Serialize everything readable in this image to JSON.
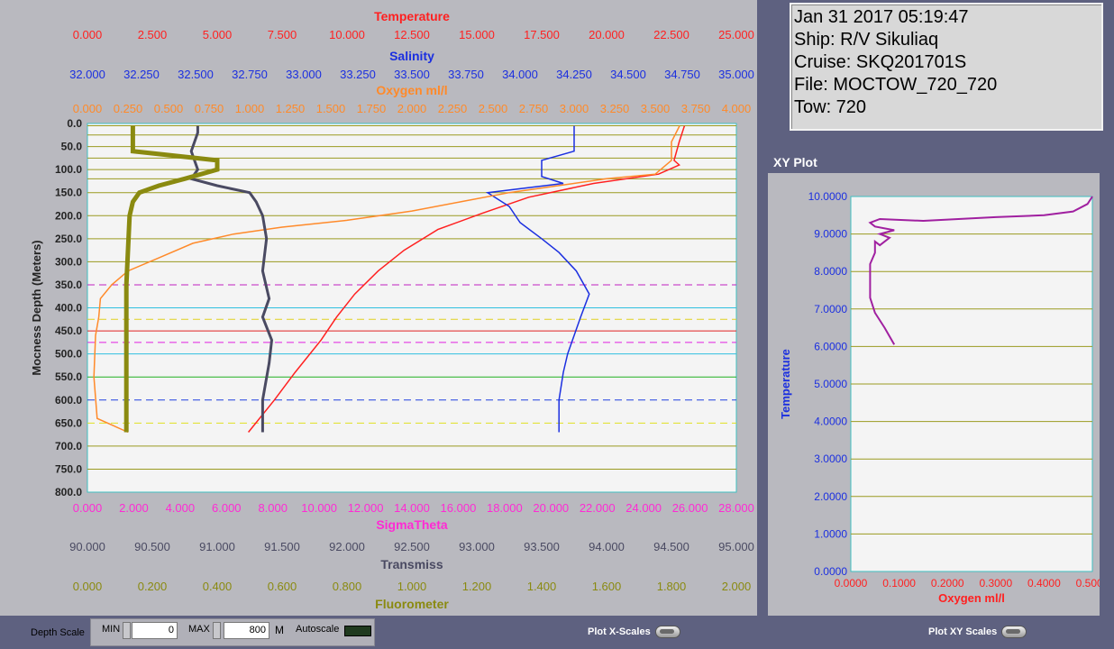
{
  "info": {
    "datetime": "Jan 31 2017 05:19:47",
    "ship": "Ship: R/V Sikuliaq",
    "cruise": "Cruise: SKQ201701S",
    "file": "File: MOCTOW_720_720",
    "tow": "Tow: 720"
  },
  "xy_plot": {
    "title": "XY Plot"
  },
  "bottom": {
    "depth_scale_label": "Depth Scale",
    "min_label": "MIN",
    "min_value": "0",
    "max_label": "MAX",
    "max_value": "800",
    "unit": "M",
    "autoscale_label": "Autoscale",
    "plot_x_scales_label": "Plot X-Scales",
    "plot_xy_scales_label": "Plot XY Scales"
  },
  "colors": {
    "temperature": "#ff2020",
    "salinity": "#1b2fe0",
    "oxygen": "#ff8a2a",
    "sigma_theta": "#ff2ad4",
    "transmiss": "#4a4a62",
    "fluorometer": "#8a8a10",
    "plot_bg": "#f4f4f4"
  },
  "chart_data": [
    {
      "type": "line",
      "ylabel": "Mocness Depth (Meters)",
      "ylim": [
        800,
        0
      ],
      "yticks": [
        "0.0",
        "50.0",
        "100.0",
        "150.0",
        "200.0",
        "250.0",
        "300.0",
        "350.0",
        "400.0",
        "450.0",
        "500.0",
        "550.0",
        "600.0",
        "650.0",
        "700.0",
        "750.0",
        "800.0"
      ],
      "top_axes": [
        {
          "name": "Temperature",
          "color": "#ff2020",
          "ticks": [
            "0.000",
            "2.500",
            "5.000",
            "7.500",
            "10.000",
            "12.500",
            "15.000",
            "17.500",
            "20.000",
            "22.500",
            "25.000"
          ]
        },
        {
          "name": "Salinity",
          "color": "#1b2fe0",
          "ticks": [
            "32.000",
            "32.250",
            "32.500",
            "32.750",
            "33.000",
            "33.250",
            "33.500",
            "33.750",
            "34.000",
            "34.250",
            "34.500",
            "34.750",
            "35.000"
          ]
        },
        {
          "name": "Oxygen ml/l",
          "color": "#ff8a2a",
          "ticks": [
            "0.000",
            "0.250",
            "0.500",
            "0.750",
            "1.000",
            "1.250",
            "1.500",
            "1.750",
            "2.000",
            "2.250",
            "2.500",
            "2.750",
            "3.000",
            "3.250",
            "3.500",
            "3.750",
            "4.000"
          ]
        }
      ],
      "bottom_axes": [
        {
          "name": "SigmaTheta",
          "color": "#ff2ad4",
          "ticks": [
            "0.000",
            "2.000",
            "4.000",
            "6.000",
            "8.000",
            "10.000",
            "12.000",
            "14.000",
            "16.000",
            "18.000",
            "20.000",
            "22.000",
            "24.000",
            "26.000",
            "28.000"
          ]
        },
        {
          "name": "Transmiss",
          "color": "#4a4a62",
          "ticks": [
            "90.000",
            "90.500",
            "91.000",
            "91.500",
            "92.000",
            "92.500",
            "93.000",
            "93.500",
            "94.000",
            "94.500",
            "95.000"
          ]
        },
        {
          "name": "Fluorometer",
          "color": "#8a8a10",
          "ticks": [
            "0.000",
            "0.200",
            "0.400",
            "0.600",
            "0.800",
            "1.000",
            "1.200",
            "1.400",
            "1.600",
            "1.800",
            "2.000"
          ]
        }
      ],
      "series": [
        {
          "name": "Temperature",
          "xlim": [
            0,
            25
          ],
          "points": [
            [
              6.2,
              670
            ],
            [
              7.2,
              600
            ],
            [
              8.0,
              540
            ],
            [
              9.0,
              470
            ],
            [
              9.6,
              420
            ],
            [
              10.3,
              370
            ],
            [
              11.2,
              320
            ],
            [
              12.2,
              275
            ],
            [
              13.5,
              230
            ],
            [
              15.2,
              195
            ],
            [
              17.0,
              160
            ],
            [
              19.5,
              130
            ],
            [
              22.0,
              110
            ],
            [
              22.8,
              90
            ],
            [
              22.6,
              80
            ],
            [
              22.8,
              40
            ],
            [
              23.0,
              5
            ]
          ]
        },
        {
          "name": "Salinity",
          "xlim": [
            32,
            35
          ],
          "points": [
            [
              34.18,
              670
            ],
            [
              34.18,
              600
            ],
            [
              34.2,
              540
            ],
            [
              34.22,
              500
            ],
            [
              34.28,
              420
            ],
            [
              34.32,
              370
            ],
            [
              34.26,
              320
            ],
            [
              34.18,
              280
            ],
            [
              34.1,
              250
            ],
            [
              34.0,
              215
            ],
            [
              33.95,
              180
            ],
            [
              33.85,
              150
            ],
            [
              34.2,
              130
            ],
            [
              34.1,
              115
            ],
            [
              34.1,
              80
            ],
            [
              34.25,
              60
            ],
            [
              34.25,
              5
            ]
          ]
        },
        {
          "name": "Oxygen ml/l",
          "xlim": [
            0,
            4
          ],
          "points": [
            [
              0.25,
              670
            ],
            [
              0.06,
              640
            ],
            [
              0.04,
              550
            ],
            [
              0.05,
              460
            ],
            [
              0.07,
              420
            ],
            [
              0.08,
              380
            ],
            [
              0.15,
              350
            ],
            [
              0.25,
              320
            ],
            [
              0.45,
              290
            ],
            [
              0.65,
              260
            ],
            [
              0.9,
              240
            ],
            [
              1.2,
              225
            ],
            [
              1.6,
              210
            ],
            [
              2.0,
              190
            ],
            [
              2.3,
              170
            ],
            [
              2.6,
              150
            ],
            [
              2.9,
              135
            ],
            [
              3.2,
              120
            ],
            [
              3.5,
              110
            ],
            [
              3.6,
              80
            ],
            [
              3.6,
              40
            ],
            [
              3.65,
              5
            ]
          ]
        },
        {
          "name": "Transmiss",
          "xlim": [
            90,
            95
          ],
          "points": [
            [
              91.35,
              670
            ],
            [
              91.35,
              600
            ],
            [
              91.4,
              520
            ],
            [
              91.42,
              470
            ],
            [
              91.35,
              420
            ],
            [
              91.4,
              380
            ],
            [
              91.35,
              320
            ],
            [
              91.38,
              250
            ],
            [
              91.35,
              200
            ],
            [
              91.3,
              170
            ],
            [
              91.25,
              150
            ],
            [
              91.0,
              135
            ],
            [
              90.8,
              120
            ],
            [
              90.85,
              100
            ],
            [
              90.8,
              60
            ],
            [
              90.85,
              20
            ],
            [
              90.85,
              5
            ]
          ]
        },
        {
          "name": "Fluorometer",
          "xlim": [
            0,
            2
          ],
          "points": [
            [
              0.12,
              670
            ],
            [
              0.12,
              350
            ],
            [
              0.13,
              200
            ],
            [
              0.14,
              170
            ],
            [
              0.16,
              150
            ],
            [
              0.22,
              135
            ],
            [
              0.3,
              120
            ],
            [
              0.4,
              100
            ],
            [
              0.4,
              80
            ],
            [
              0.14,
              60
            ],
            [
              0.14,
              5
            ]
          ]
        }
      ],
      "horizontal_lines": [
        {
          "y": 5,
          "color": "#9a9a20",
          "dash": false
        },
        {
          "y": 25,
          "color": "#9a9a20",
          "dash": false
        },
        {
          "y": 50,
          "color": "#9a9a20",
          "dash": false
        },
        {
          "y": 75,
          "color": "#9a9a20",
          "dash": false
        },
        {
          "y": 100,
          "color": "#9a9a20",
          "dash": false
        },
        {
          "y": 120,
          "color": "#9a9a20",
          "dash": false
        },
        {
          "y": 150,
          "color": "#9a9a20",
          "dash": false
        },
        {
          "y": 200,
          "color": "#9a9a20",
          "dash": false
        },
        {
          "y": 250,
          "color": "#9a9a20",
          "dash": false
        },
        {
          "y": 300,
          "color": "#9a9a20",
          "dash": false
        },
        {
          "y": 350,
          "color": "#c020c0",
          "dash": true
        },
        {
          "y": 400,
          "color": "#30c0e0",
          "dash": false
        },
        {
          "y": 425,
          "color": "#e0d020",
          "dash": true
        },
        {
          "y": 450,
          "color": "#e02020",
          "dash": false
        },
        {
          "y": 475,
          "color": "#e020e0",
          "dash": true
        },
        {
          "y": 500,
          "color": "#30c0e0",
          "dash": false
        },
        {
          "y": 550,
          "color": "#20b020",
          "dash": false
        },
        {
          "y": 600,
          "color": "#2040e0",
          "dash": true
        },
        {
          "y": 650,
          "color": "#e0e020",
          "dash": true
        },
        {
          "y": 700,
          "color": "#9a9a20",
          "dash": false
        },
        {
          "y": 750,
          "color": "#9a9a20",
          "dash": false
        }
      ]
    },
    {
      "type": "line",
      "xlabel": "Oxygen ml/l",
      "ylabel": "Temperature",
      "xlim": [
        0,
        0.5
      ],
      "ylim": [
        0,
        10
      ],
      "xticks": [
        "0.0000",
        "0.1000",
        "0.2000",
        "0.3000",
        "0.4000",
        "0.5000"
      ],
      "yticks": [
        "0.0000",
        "1.0000",
        "2.0000",
        "3.0000",
        "4.0000",
        "5.0000",
        "6.0000",
        "7.0000",
        "8.0000",
        "9.0000",
        "10.0000"
      ],
      "series": [
        {
          "name": "Temperature vs Oxygen",
          "x": [
            0.09,
            0.07,
            0.05,
            0.04,
            0.04,
            0.04,
            0.05,
            0.05,
            0.06,
            0.08,
            0.06,
            0.09,
            0.05,
            0.04,
            0.06,
            0.15,
            0.3,
            0.4,
            0.46,
            0.49,
            0.5
          ],
          "y": [
            6.05,
            6.5,
            6.9,
            7.3,
            7.8,
            8.2,
            8.5,
            8.8,
            8.7,
            8.9,
            9.0,
            9.1,
            9.2,
            9.3,
            9.4,
            9.35,
            9.45,
            9.5,
            9.6,
            9.8,
            10.0
          ]
        }
      ]
    }
  ]
}
